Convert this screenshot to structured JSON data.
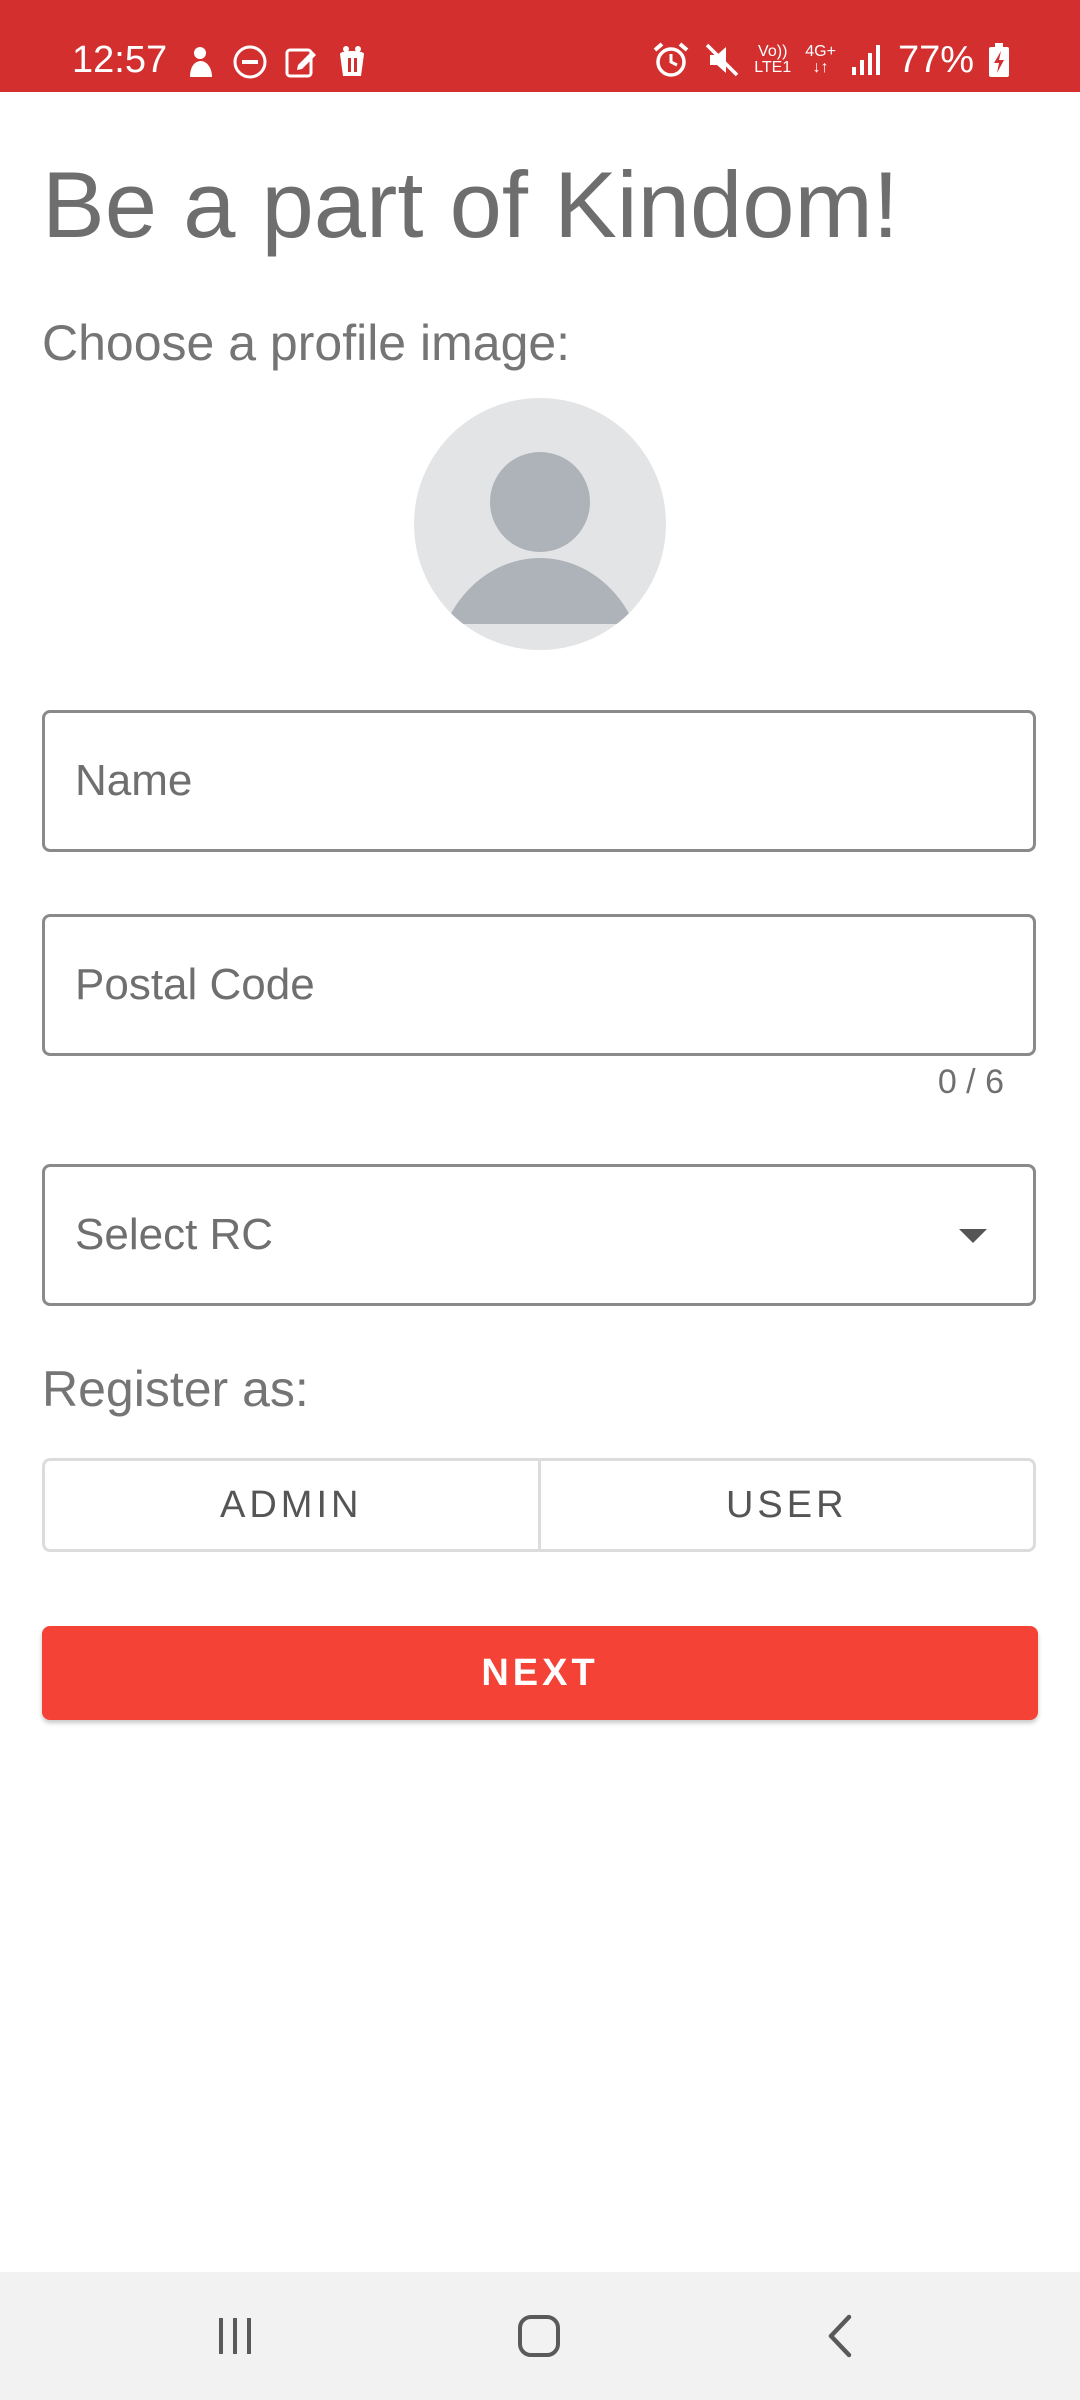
{
  "status_bar": {
    "time": "12:57",
    "network_top": "Vo))",
    "network_bottom": "LTE1",
    "network_type": "4G+",
    "battery": "77%",
    "left_icons": [
      "person-notification-icon",
      "do-not-disturb-icon",
      "edit-icon",
      "app-notification-icon"
    ],
    "right_icons": [
      "alarm-icon",
      "mute-icon",
      "signal-icon",
      "battery-charging-icon"
    ]
  },
  "page": {
    "title": "Be a part of Kindom!",
    "profile_label": "Choose a profile image:"
  },
  "form": {
    "name_placeholder": "Name",
    "postal_placeholder": "Postal Code",
    "postal_counter": "0 / 6",
    "select_rc_label": "Select RC",
    "register_label": "Register as:",
    "roles": [
      "ADMIN",
      "USER"
    ],
    "next_label": "NEXT"
  },
  "colors": {
    "status_bar": "#d32f2f",
    "accent": "#f44336",
    "nav_bar": "#f2f2f2"
  },
  "nav_bar": {
    "buttons": [
      "recents-icon",
      "home-icon",
      "back-icon"
    ]
  }
}
